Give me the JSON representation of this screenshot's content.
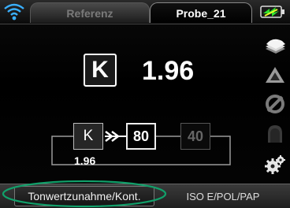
{
  "tabs": [
    {
      "label": "Referenz",
      "active": false
    },
    {
      "label": "Probe_21",
      "active": true
    }
  ],
  "status": {
    "wifi_icon": "wifi-icon",
    "battery_icon": "battery-icon",
    "accent": "#2fe22f"
  },
  "measurement": {
    "channel": "K",
    "value": "1.96"
  },
  "process": {
    "nodes": [
      {
        "label": "K",
        "state": "selected"
      },
      {
        "label": "80",
        "state": "active"
      },
      {
        "label": "40",
        "state": "inactive"
      }
    ],
    "subvalue": "1.96"
  },
  "toolbar": {
    "icons": [
      "paper-stack-icon",
      "triangle-icon",
      "no-symbol-icon",
      "disabled-tool-icon",
      "gears-icon"
    ]
  },
  "bottom": {
    "left_label": "Tonwertzunahme/Kont.",
    "right_label": "ISO E/POL/PAP",
    "highlight_color": "#11a06a"
  }
}
